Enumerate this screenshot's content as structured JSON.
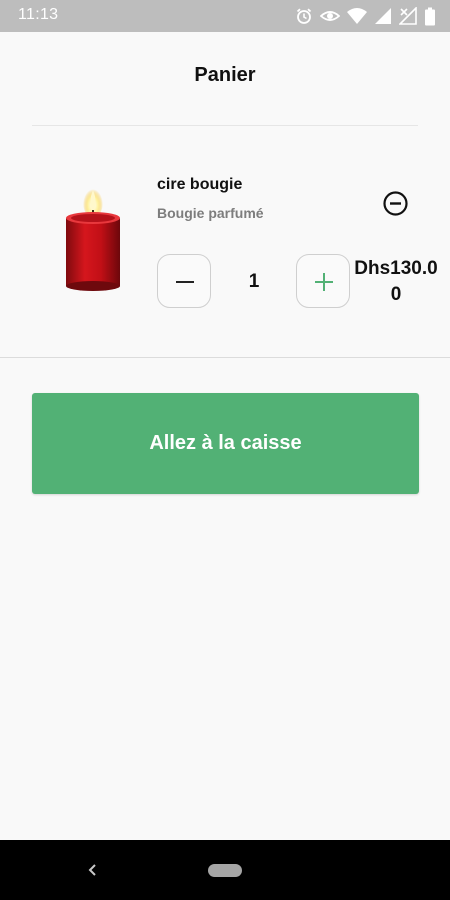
{
  "status_bar": {
    "time": "11:13",
    "icons": [
      "alarm-icon",
      "eye-icon",
      "wifi-icon",
      "signal-icon",
      "no-signal-icon",
      "battery-icon"
    ]
  },
  "header": {
    "title": "Panier"
  },
  "cart": {
    "items": [
      {
        "name": "cire bougie",
        "subtitle": "Bougie parfumé",
        "image": "red-candle-image",
        "quantity": "1",
        "price": "Dhs130.00"
      }
    ]
  },
  "checkout": {
    "label": "Allez à la caisse"
  },
  "nav_bar": {
    "icons": [
      "back-icon",
      "home-pill-icon"
    ]
  },
  "colors": {
    "accent": "#52b175",
    "status_bar": "#bdbdbd",
    "background": "#f9f9f9",
    "candle_red": "#c0141a",
    "subtitle_gray": "#7d7d7d"
  }
}
